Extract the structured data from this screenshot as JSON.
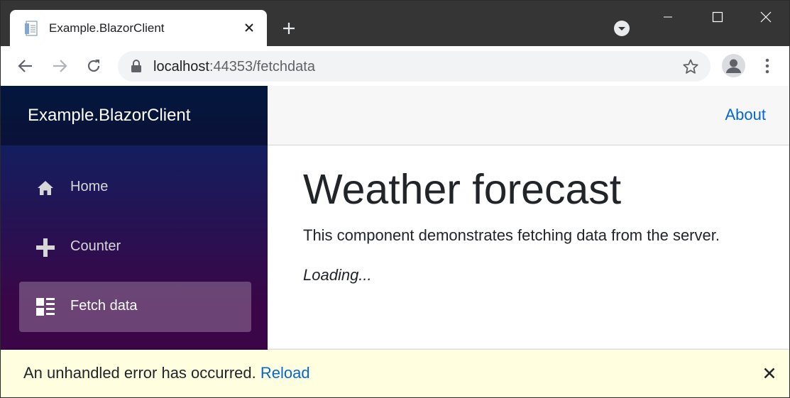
{
  "browser": {
    "tab_title": "Example.BlazorClient",
    "url_host": "localhost",
    "url_path": ":44353/fetchdata"
  },
  "app": {
    "brand": "Example.BlazorClient",
    "about_label": "About",
    "nav": [
      {
        "label": "Home",
        "icon": "home-icon"
      },
      {
        "label": "Counter",
        "icon": "plus-icon"
      },
      {
        "label": "Fetch data",
        "icon": "list-icon"
      }
    ],
    "active_nav": "Fetch data"
  },
  "page": {
    "title": "Weather forecast",
    "description": "This component demonstrates fetching data from the server.",
    "loading": "Loading..."
  },
  "error": {
    "message": "An unhandled error has occurred.",
    "reload_label": "Reload"
  },
  "colors": {
    "link": "#0366d6",
    "sidebar_top": "#052767",
    "sidebar_bottom": "#3a0647",
    "error_bg": "#ffffe0"
  }
}
